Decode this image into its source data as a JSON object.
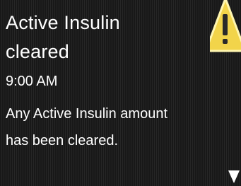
{
  "alert": {
    "title_line1": "Active Insulin",
    "title_line2": "cleared",
    "time": "9:00 AM",
    "message_line1": "Any Active Insulin amount",
    "message_line2": "has been cleared."
  },
  "icons": {
    "warning": "warning-triangle-icon",
    "scroll": "scroll-down-arrow-icon"
  },
  "colors": {
    "background": "#1f1f1f",
    "text": "#ffffff",
    "warning": "#f2d44a"
  }
}
